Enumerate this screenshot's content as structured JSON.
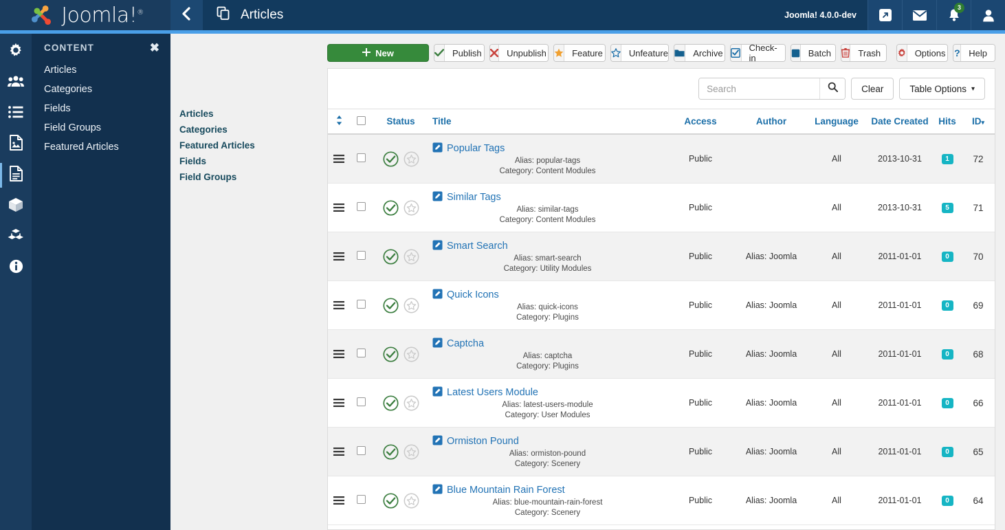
{
  "brand": {
    "name": "Joomla!",
    "registered": "®"
  },
  "header": {
    "back_icon": "chevron-left-icon",
    "page_icon": "articles-icon",
    "title": "Articles",
    "version": "Joomla! 4.0.0-dev",
    "icons": [
      {
        "name": "preview-site-icon",
        "glyph": "↗"
      },
      {
        "name": "messages-icon",
        "glyph": "✉"
      },
      {
        "name": "notifications-icon",
        "glyph": "🔔",
        "badge": "3"
      },
      {
        "name": "user-account-icon",
        "glyph": "👤"
      }
    ]
  },
  "rail": [
    {
      "name": "system-gear-icon",
      "active": false
    },
    {
      "name": "users-icon",
      "active": false
    },
    {
      "name": "menus-list-icon",
      "active": false
    },
    {
      "name": "media-image-icon",
      "active": false
    },
    {
      "name": "content-document-icon",
      "active": true
    },
    {
      "name": "extensions-box-icon",
      "active": false
    },
    {
      "name": "modules-blocks-icon",
      "active": false
    },
    {
      "name": "help-info-icon",
      "active": false
    }
  ],
  "menu_panel": {
    "title": "CONTENT",
    "close_label": "✖",
    "items": [
      {
        "label": "Articles"
      },
      {
        "label": "Categories"
      },
      {
        "label": "Fields"
      },
      {
        "label": "Field Groups"
      },
      {
        "label": "Featured Articles"
      }
    ]
  },
  "subnav": {
    "items": [
      {
        "label": "Articles"
      },
      {
        "label": "Categories"
      },
      {
        "label": "Featured Articles"
      },
      {
        "label": "Fields"
      },
      {
        "label": "Field Groups"
      }
    ]
  },
  "toolbar": {
    "new_label": "New",
    "new_icon": "plus-icon",
    "buttons": [
      {
        "label": "Publish",
        "icon": "check-icon",
        "color": "#3a7d3e"
      },
      {
        "label": "Unpublish",
        "icon": "x-mark-icon",
        "color": "#c9453f"
      },
      {
        "label": "Feature",
        "icon": "star-filled-icon",
        "color": "#f0a030"
      },
      {
        "label": "Unfeature",
        "icon": "star-outline-icon",
        "color": "#1a6ea8"
      },
      {
        "label": "Archive",
        "icon": "folder-icon",
        "color": "#15618f"
      },
      {
        "label": "Check-in",
        "icon": "checkbox-icon",
        "color": "#1a6ea8"
      },
      {
        "label": "Batch",
        "icon": "square-icon",
        "color": "#15618f"
      },
      {
        "label": "Trash",
        "icon": "trash-icon",
        "color": "#c9453f"
      }
    ],
    "right_buttons": [
      {
        "label": "Options",
        "icon": "gear-icon",
        "color": "#c9453f"
      },
      {
        "label": "Help",
        "icon": "question-icon",
        "color": "#1a6ea8"
      }
    ]
  },
  "filters": {
    "search_placeholder": "Search",
    "search_value": "",
    "search_icon": "magnifier-icon",
    "clear_label": "Clear",
    "table_options_label": "Table Options",
    "table_options_caret": "▾"
  },
  "table": {
    "columns": {
      "ordering": "↕",
      "select_all": "checkbox",
      "status": "Status",
      "title": "Title",
      "access": "Access",
      "author": "Author",
      "language": "Language",
      "date_created": "Date Created",
      "hits": "Hits",
      "id": "ID",
      "id_caret": "▾"
    },
    "alias_prefix": "Alias:",
    "category_prefix": "Category:",
    "rows": [
      {
        "title": "Popular Tags",
        "alias": "popular-tags",
        "category": "Content Modules",
        "access": "Public",
        "author": "",
        "language": "All",
        "date": "2013-10-31",
        "hits": "1",
        "id": "72",
        "published": true,
        "featured": false
      },
      {
        "title": "Similar Tags",
        "alias": "similar-tags",
        "category": "Content Modules",
        "access": "Public",
        "author": "",
        "language": "All",
        "date": "2013-10-31",
        "hits": "5",
        "id": "71",
        "published": true,
        "featured": false
      },
      {
        "title": "Smart Search",
        "alias": "smart-search",
        "category": "Utility Modules",
        "access": "Public",
        "author": "Alias: Joomla",
        "language": "All",
        "date": "2011-01-01",
        "hits": "0",
        "id": "70",
        "published": true,
        "featured": false
      },
      {
        "title": "Quick Icons",
        "alias": "quick-icons",
        "category": "Plugins",
        "access": "Public",
        "author": "Alias: Joomla",
        "language": "All",
        "date": "2011-01-01",
        "hits": "0",
        "id": "69",
        "published": true,
        "featured": false
      },
      {
        "title": "Captcha",
        "alias": "captcha",
        "category": "Plugins",
        "access": "Public",
        "author": "Alias: Joomla",
        "language": "All",
        "date": "2011-01-01",
        "hits": "0",
        "id": "68",
        "published": true,
        "featured": false
      },
      {
        "title": "Latest Users Module",
        "alias": "latest-users-module",
        "category": "User Modules",
        "access": "Public",
        "author": "Alias: Joomla",
        "language": "All",
        "date": "2011-01-01",
        "hits": "0",
        "id": "66",
        "published": true,
        "featured": false
      },
      {
        "title": "Ormiston Pound",
        "alias": "ormiston-pound",
        "category": "Scenery",
        "access": "Public",
        "author": "Alias: Joomla",
        "language": "All",
        "date": "2011-01-01",
        "hits": "0",
        "id": "65",
        "published": true,
        "featured": false
      },
      {
        "title": "Blue Mountain Rain Forest",
        "alias": "blue-mountain-rain-forest",
        "category": "Scenery",
        "access": "Public",
        "author": "Alias: Joomla",
        "language": "All",
        "date": "2011-01-01",
        "hits": "0",
        "id": "64",
        "published": true,
        "featured": false
      }
    ]
  },
  "colors": {
    "header_bg": "#12365c",
    "rail_bg": "#1a3c5e",
    "accent": "#4a9fe8",
    "new_green": "#368a3b",
    "link_blue": "#2273b5",
    "hits_teal": "#16b5c4",
    "heading_blue": "#1a6ea8"
  }
}
